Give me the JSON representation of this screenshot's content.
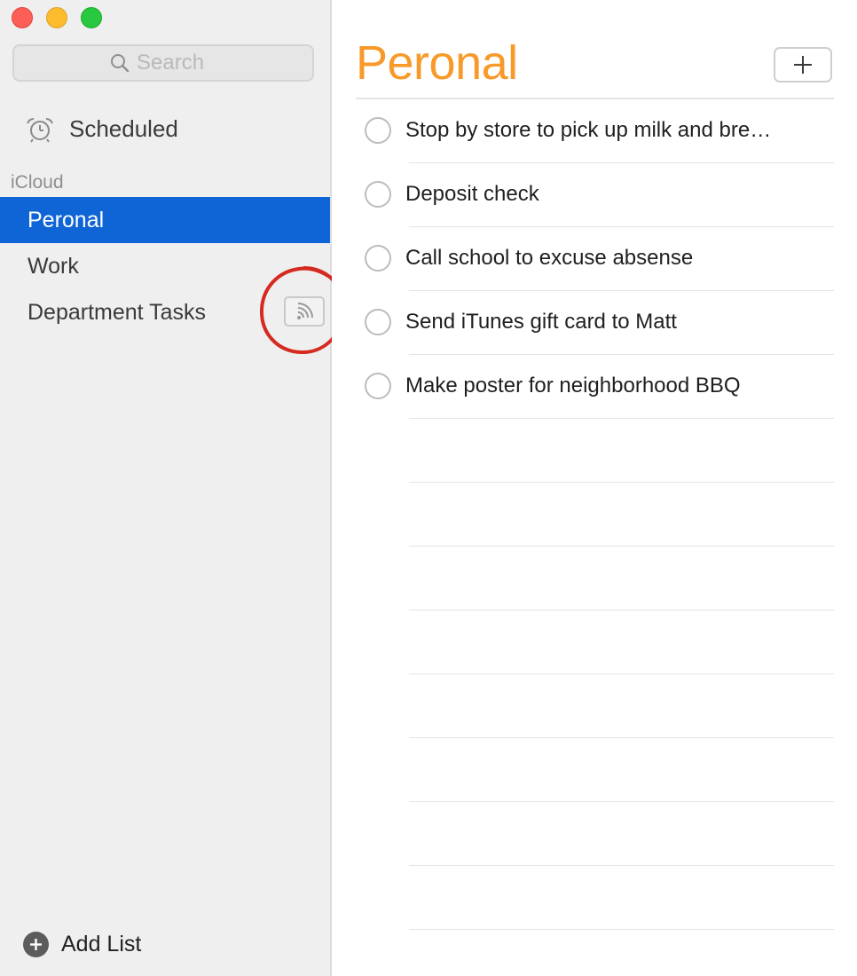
{
  "window": {
    "traffic_lights": [
      "close",
      "minimize",
      "zoom"
    ]
  },
  "sidebar": {
    "search": {
      "placeholder": "Search",
      "value": ""
    },
    "scheduled_label": "Scheduled",
    "section_label": "iCloud",
    "lists": [
      {
        "label": "Peronal",
        "selected": true
      },
      {
        "label": "Work",
        "selected": false
      },
      {
        "label": "Department Tasks",
        "selected": false,
        "shared": true
      }
    ],
    "add_list_label": "Add List"
  },
  "main": {
    "title": "Peronal",
    "reminders": [
      {
        "text": "Stop by store to pick up milk and bre…",
        "done": false
      },
      {
        "text": "Deposit check",
        "done": false
      },
      {
        "text": "Call school to excuse absense",
        "done": false
      },
      {
        "text": "Send iTunes gift card to Matt",
        "done": false
      },
      {
        "text": "Make poster for neighborhood BBQ",
        "done": false
      }
    ]
  },
  "colors": {
    "accent_title": "#f89a2a",
    "selection": "#1065d6",
    "annotation": "#d42a20"
  },
  "icons": {
    "search": "search-icon",
    "scheduled": "alarm-clock-icon",
    "shared": "shared-list-icon",
    "add_list": "plus-circle-icon",
    "add_reminder": "plus-icon"
  }
}
